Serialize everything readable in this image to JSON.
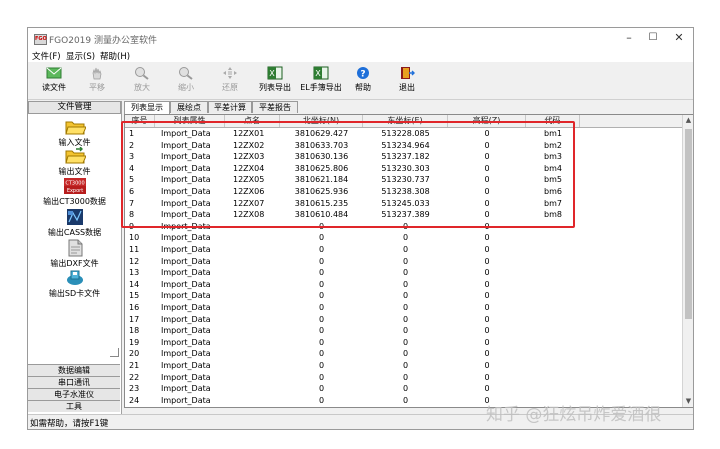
{
  "window": {
    "title": "FGO2019 测量办公室软件"
  },
  "menu": [
    "文件(F)",
    "显示(S)",
    "帮助(H)"
  ],
  "toolbar": [
    {
      "label": "读文件",
      "icon": "envelope-icon",
      "enabled": true
    },
    {
      "label": "平移",
      "icon": "hand-icon",
      "enabled": false
    },
    {
      "label": "放大",
      "icon": "zoom-in-icon",
      "enabled": false
    },
    {
      "label": "缩小",
      "icon": "zoom-out-icon",
      "enabled": false
    },
    {
      "label": "还原",
      "icon": "restore-icon",
      "enabled": false
    },
    {
      "label": "列表导出",
      "icon": "excel-icon",
      "enabled": true
    },
    {
      "label": "EL手簿导出",
      "icon": "excel-icon",
      "enabled": true
    },
    {
      "label": "帮助",
      "icon": "help-icon",
      "enabled": true
    },
    {
      "label": "退出",
      "icon": "exit-door-icon",
      "enabled": true
    }
  ],
  "sidebar": {
    "header": "文件管理",
    "items": [
      {
        "label": "输入文件",
        "icon": "folder-open-icon"
      },
      {
        "label": "输出文件",
        "icon": "folder-export-icon"
      },
      {
        "label": "输出CT3000数据",
        "icon": "ct3000-export-icon",
        "badge_top": "CT3000",
        "badge_bottom": "Export"
      },
      {
        "label": "输出CASS数据",
        "icon": "cass-export-icon"
      },
      {
        "label": "输出DXF文件",
        "icon": "dxf-file-icon"
      },
      {
        "label": "输出SD卡文件",
        "icon": "sd-card-icon"
      }
    ],
    "tabs": [
      "数据编辑",
      "串口通讯",
      "电子水准仪",
      "工具"
    ]
  },
  "tabs": [
    "列表显示",
    "展绘点",
    "平差计算",
    "平差报告"
  ],
  "table": {
    "columns": [
      "序号",
      "列表属性",
      "点名",
      "北坐标(N)",
      "东坐标(E)",
      "高程(Z)",
      "代码"
    ],
    "rows": [
      [
        "1",
        "Import_Data",
        "12ZX01",
        "3810629.427",
        "513228.085",
        "0",
        "bm1"
      ],
      [
        "2",
        "Import_Data",
        "12ZX02",
        "3810633.703",
        "513234.964",
        "0",
        "bm2"
      ],
      [
        "3",
        "Import_Data",
        "12ZX03",
        "3810630.136",
        "513237.182",
        "0",
        "bm3"
      ],
      [
        "4",
        "Import_Data",
        "12ZX04",
        "3810625.806",
        "513230.303",
        "0",
        "bm4"
      ],
      [
        "5",
        "Import_Data",
        "12ZX05",
        "3810621.184",
        "513230.737",
        "0",
        "bm5"
      ],
      [
        "6",
        "Import_Data",
        "12ZX06",
        "3810625.936",
        "513238.308",
        "0",
        "bm6"
      ],
      [
        "7",
        "Import_Data",
        "12ZX07",
        "3810615.235",
        "513245.033",
        "0",
        "bm7"
      ],
      [
        "8",
        "Import_Data",
        "12ZX08",
        "3810610.484",
        "513237.389",
        "0",
        "bm8"
      ],
      [
        "9",
        "Import_Data",
        "",
        "0",
        "0",
        "0",
        ""
      ],
      [
        "10",
        "Import_Data",
        "",
        "0",
        "0",
        "0",
        ""
      ],
      [
        "11",
        "Import_Data",
        "",
        "0",
        "0",
        "0",
        ""
      ],
      [
        "12",
        "Import_Data",
        "",
        "0",
        "0",
        "0",
        ""
      ],
      [
        "13",
        "Import_Data",
        "",
        "0",
        "0",
        "0",
        ""
      ],
      [
        "14",
        "Import_Data",
        "",
        "0",
        "0",
        "0",
        ""
      ],
      [
        "15",
        "Import_Data",
        "",
        "0",
        "0",
        "0",
        ""
      ],
      [
        "16",
        "Import_Data",
        "",
        "0",
        "0",
        "0",
        ""
      ],
      [
        "17",
        "Import_Data",
        "",
        "0",
        "0",
        "0",
        ""
      ],
      [
        "18",
        "Import_Data",
        "",
        "0",
        "0",
        "0",
        ""
      ],
      [
        "19",
        "Import_Data",
        "",
        "0",
        "0",
        "0",
        ""
      ],
      [
        "20",
        "Import_Data",
        "",
        "0",
        "0",
        "0",
        ""
      ],
      [
        "21",
        "Import_Data",
        "",
        "0",
        "0",
        "0",
        ""
      ],
      [
        "22",
        "Import_Data",
        "",
        "0",
        "0",
        "0",
        ""
      ],
      [
        "23",
        "Import_Data",
        "",
        "0",
        "0",
        "0",
        ""
      ],
      [
        "24",
        "Import_Data",
        "",
        "0",
        "0",
        "0",
        ""
      ]
    ]
  },
  "status": "如需帮助，请按F1键",
  "watermark": "知乎 @狂炫吊炸爱酒很",
  "colors": {
    "highlight": "#e0262a"
  }
}
